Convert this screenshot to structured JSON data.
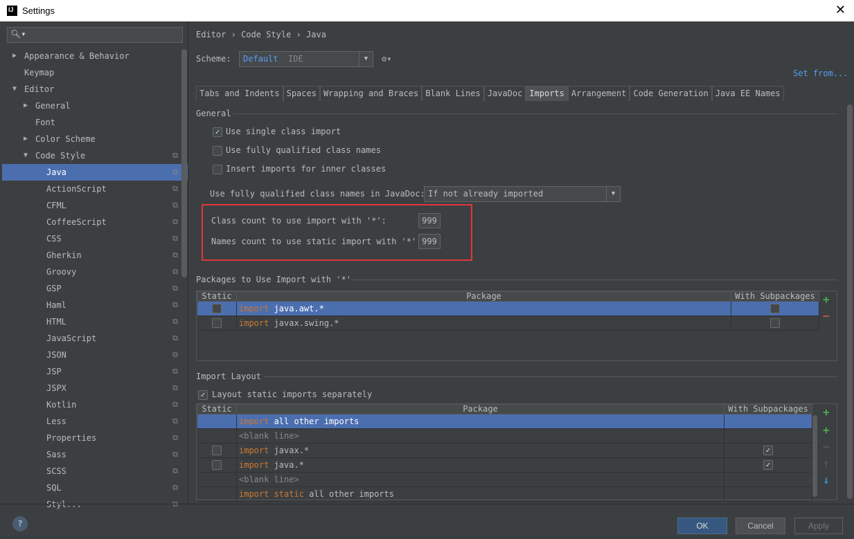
{
  "window": {
    "title": "Settings",
    "logo": "IJ",
    "close": "✕"
  },
  "sidebar": {
    "search_icon": "search-icon",
    "items": [
      {
        "label": "Appearance & Behavior",
        "level": 0,
        "arrow": "▶"
      },
      {
        "label": "Keymap",
        "level": 0,
        "arrow": ""
      },
      {
        "label": "Editor",
        "level": 0,
        "arrow": "▼"
      },
      {
        "label": "General",
        "level": 1,
        "arrow": "▶"
      },
      {
        "label": "Font",
        "level": 1,
        "arrow": ""
      },
      {
        "label": "Color Scheme",
        "level": 1,
        "arrow": "▶"
      },
      {
        "label": "Code Style",
        "level": 1,
        "arrow": "▼",
        "copy": true
      },
      {
        "label": "Java",
        "level": 2,
        "selected": true,
        "copy": true
      },
      {
        "label": "ActionScript",
        "level": 2,
        "copy": true
      },
      {
        "label": "CFML",
        "level": 2,
        "copy": true
      },
      {
        "label": "CoffeeScript",
        "level": 2,
        "copy": true
      },
      {
        "label": "CSS",
        "level": 2,
        "copy": true
      },
      {
        "label": "Gherkin",
        "level": 2,
        "copy": true
      },
      {
        "label": "Groovy",
        "level": 2,
        "copy": true
      },
      {
        "label": "GSP",
        "level": 2,
        "copy": true
      },
      {
        "label": "Haml",
        "level": 2,
        "copy": true
      },
      {
        "label": "HTML",
        "level": 2,
        "copy": true
      },
      {
        "label": "JavaScript",
        "level": 2,
        "copy": true
      },
      {
        "label": "JSON",
        "level": 2,
        "copy": true
      },
      {
        "label": "JSP",
        "level": 2,
        "copy": true
      },
      {
        "label": "JSPX",
        "level": 2,
        "copy": true
      },
      {
        "label": "Kotlin",
        "level": 2,
        "copy": true
      },
      {
        "label": "Less",
        "level": 2,
        "copy": true
      },
      {
        "label": "Properties",
        "level": 2,
        "copy": true
      },
      {
        "label": "Sass",
        "level": 2,
        "copy": true
      },
      {
        "label": "SCSS",
        "level": 2,
        "copy": true
      },
      {
        "label": "SQL",
        "level": 2,
        "copy": true
      },
      {
        "label": "Styl...",
        "level": 2,
        "copy": true
      }
    ]
  },
  "breadcrumb": [
    "Editor",
    "Code Style",
    "Java"
  ],
  "breadcrumb_sep": "›",
  "scheme": {
    "label": "Scheme:",
    "value": "Default",
    "tag": "IDE",
    "gear": "⚙▾",
    "set_from": "Set from..."
  },
  "tabs": [
    "Tabs and Indents",
    "Spaces",
    "Wrapping and Braces",
    "Blank Lines",
    "JavaDoc",
    "Imports",
    "Arrangement",
    "Code Generation",
    "Java EE Names"
  ],
  "active_tab": "Imports",
  "general": {
    "title": "General",
    "checkboxes": [
      {
        "label": "Use single class import",
        "checked": true
      },
      {
        "label": "Use fully qualified class names",
        "checked": false
      },
      {
        "label": "Insert imports for inner classes",
        "checked": false
      }
    ],
    "javadoc_label": "Use fully qualified class names in JavaDoc:",
    "javadoc_value": "If not already imported",
    "class_count_label": "Class count to use import with '*':",
    "class_count": "999",
    "names_count_label": "Names count to use static import with '*':",
    "names_count": "999",
    "highlight_color": "#e0373d"
  },
  "packages": {
    "title": "Packages to Use Import with '*'",
    "headers": [
      "Static",
      "Package",
      "With Subpackages"
    ],
    "rows": [
      {
        "kw": "import",
        "pkg": " java.awt.*",
        "static": false,
        "sub": false,
        "selected": true
      },
      {
        "kw": "import",
        "pkg": " javax.swing.*",
        "static": false,
        "sub": false
      }
    ],
    "add": "+",
    "remove": "−"
  },
  "layout": {
    "title": "Import Layout",
    "separate_label": "Layout static imports separately",
    "separate_checked": true,
    "headers": [
      "Static",
      "Package",
      "With Subpackages"
    ],
    "rows": [
      {
        "kw": "import",
        "pkg": " all other imports",
        "selected": true,
        "cb": false
      },
      {
        "kw": "",
        "pkg": "<blank line>",
        "grey": true,
        "cb": false
      },
      {
        "kw": "import",
        "pkg": " javax.*",
        "cb": true,
        "sub": true
      },
      {
        "kw": "import",
        "pkg": " java.*",
        "cb": true,
        "sub": true
      },
      {
        "kw": "",
        "pkg": "<blank line>",
        "grey": true,
        "cb": false
      },
      {
        "kw": "import static",
        "pkg": " all other imports",
        "cb": false
      }
    ]
  },
  "buttons": {
    "ok": "OK",
    "cancel": "Cancel",
    "apply": "Apply",
    "help": "?"
  },
  "colors": {
    "selection": "#4b6eaf",
    "keyword": "#cc7832",
    "background": "#3c3f41"
  }
}
